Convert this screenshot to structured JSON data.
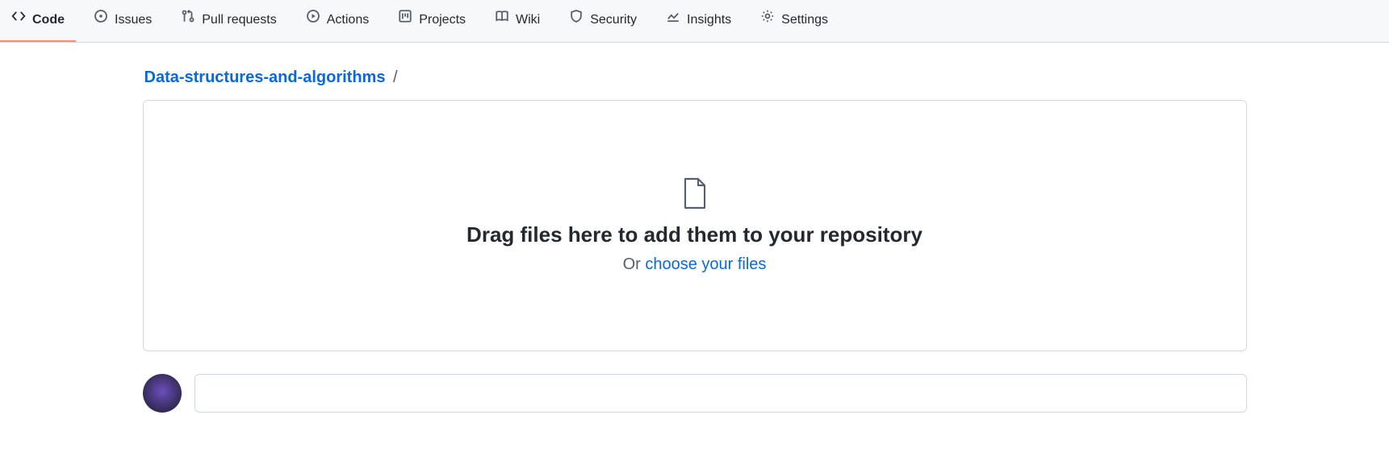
{
  "tabs": {
    "code": {
      "label": "Code"
    },
    "issues": {
      "label": "Issues"
    },
    "pulls": {
      "label": "Pull requests"
    },
    "actions": {
      "label": "Actions"
    },
    "projects": {
      "label": "Projects"
    },
    "wiki": {
      "label": "Wiki"
    },
    "security": {
      "label": "Security"
    },
    "insights": {
      "label": "Insights"
    },
    "settings": {
      "label": "Settings"
    }
  },
  "breadcrumb": {
    "repo": "Data-structures-and-algorithms",
    "sep": "/"
  },
  "dropzone": {
    "heading": "Drag files here to add them to your repository",
    "or_text": "Or ",
    "choose_link": "choose your files"
  }
}
